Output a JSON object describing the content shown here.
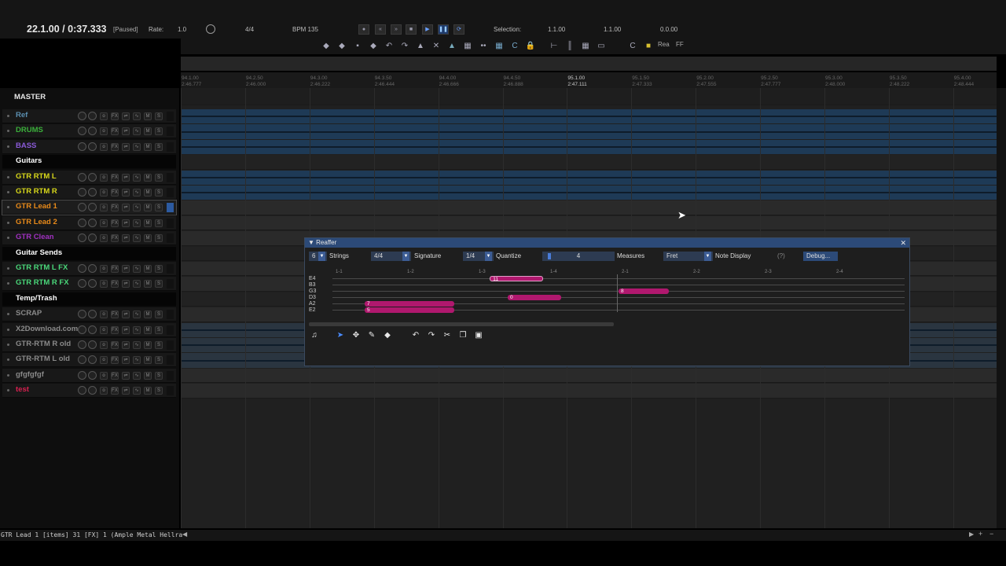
{
  "transport": {
    "position": "22.1.00 / 0:37.333",
    "state": "[Paused]",
    "rate_label": "Rate:",
    "rate_value": "1.0",
    "time_signature": "4/4",
    "bpm": "BPM 135",
    "selection_label": "Selection:",
    "sel_start": "1.1.00",
    "sel_end": "1.1.00",
    "sel_length": "0.0.00"
  },
  "toolbar": {
    "rea_label": "Rea",
    "ff_label": "FF"
  },
  "master": {
    "label": "MASTER"
  },
  "tracks": [
    {
      "name": "Ref",
      "color": "#5b8fb0",
      "folder": false
    },
    {
      "name": "DRUMS",
      "color": "#3bb03b",
      "folder": false
    },
    {
      "name": "BASS",
      "color": "#8a5ad8",
      "folder": false
    },
    {
      "name": "Guitars",
      "color": "#ffffff",
      "folder": true
    },
    {
      "name": "GTR RTM L",
      "color": "#d8d81a",
      "folder": false
    },
    {
      "name": "GTR RTM R",
      "color": "#d8d81a",
      "folder": false
    },
    {
      "name": "GTR Lead 1",
      "color": "#e88a1a",
      "folder": false
    },
    {
      "name": "GTR Lead 2",
      "color": "#e88a1a",
      "folder": false
    },
    {
      "name": "GTR Clean",
      "color": "#a030c0",
      "folder": false
    },
    {
      "name": "Guitar Sends",
      "color": "#ffffff",
      "folder": true
    },
    {
      "name": "GTR RTM L FX",
      "color": "#4ad87a",
      "folder": false
    },
    {
      "name": "GTR RTM R FX",
      "color": "#4ad87a",
      "folder": false
    },
    {
      "name": "Temp/Trash",
      "color": "#ffffff",
      "folder": true
    },
    {
      "name": "SCRAP",
      "color": "#8a8a8a",
      "folder": false
    },
    {
      "name": "X2Download.com",
      "color": "#8a8a8a",
      "folder": false
    },
    {
      "name": "GTR-RTM R old",
      "color": "#8a8a8a",
      "folder": false
    },
    {
      "name": "GTR-RTM L old",
      "color": "#8a8a8a",
      "folder": false
    },
    {
      "name": "gfgfgfgf",
      "color": "#8a8a8a",
      "folder": false
    },
    {
      "name": "test",
      "color": "#d82050",
      "folder": false
    }
  ],
  "ruler": {
    "bars": [
      "94.1.00",
      "94.2.50",
      "94.3.00",
      "94.3.50",
      "94.4.00",
      "94.4.50",
      "95.1.00",
      "95.1.50",
      "95.2.00",
      "95.2.50",
      "95.3.00",
      "95.3.50",
      "95.4.00"
    ],
    "times": [
      "2:46.777",
      "2:46.000",
      "2:46.222",
      "2:46.444",
      "2:46.666",
      "2:46.888",
      "2:47.111",
      "2:47.333",
      "2:47.555",
      "2:47.777",
      "2:48.000",
      "2:48.222",
      "2:48.444"
    ]
  },
  "reaffer": {
    "title": "Reaffer",
    "strings_value": "6",
    "strings_label": "Strings",
    "signature_value": "4/4",
    "signature_label": "Signature",
    "quantize_value": "1/4",
    "quantize_label": "Quantize",
    "measures_value": "4",
    "measures_label": "Measures",
    "display_value": "Fret",
    "display_label": "Note Display",
    "help": "(?)",
    "debug_label": "Debug...",
    "measure_marks": [
      "1-1",
      "1-2",
      "1-3",
      "1-4",
      "2-1",
      "2-2",
      "2-3",
      "2-4"
    ],
    "string_names": [
      "E4",
      "B3",
      "G3",
      "D3",
      "A2",
      "E2"
    ],
    "notes": [
      {
        "string": 0,
        "fret": "11",
        "start": 2.2,
        "len": 0.75
      },
      {
        "string": 2,
        "fret": "8",
        "start": 4.0,
        "len": 0.7
      },
      {
        "string": 3,
        "fret": "0",
        "start": 2.45,
        "len": 0.75
      },
      {
        "string": 4,
        "fret": "7",
        "start": 0.45,
        "len": 1.25
      },
      {
        "string": 5,
        "fret": "5",
        "start": 0.45,
        "len": 1.25
      }
    ]
  },
  "status": {
    "text": "GTR Lead 1 [items] 31 [FX] 1 (Ample Metal Hellra"
  }
}
